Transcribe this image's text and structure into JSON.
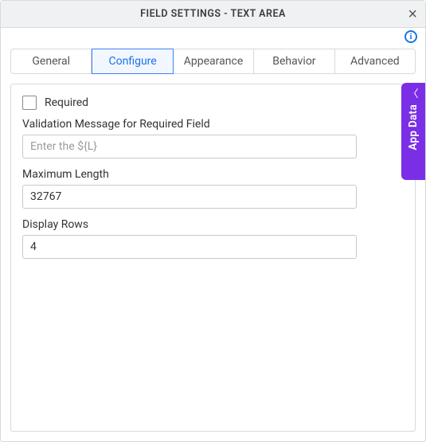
{
  "header": {
    "title": "FIELD SETTINGS - TEXT AREA"
  },
  "tabs": [
    {
      "label": "General",
      "active": false
    },
    {
      "label": "Configure",
      "active": true
    },
    {
      "label": "Appearance",
      "active": false
    },
    {
      "label": "Behavior",
      "active": false
    },
    {
      "label": "Advanced",
      "active": false
    }
  ],
  "form": {
    "required_label": "Required",
    "required_checked": false,
    "validation_label": "Validation Message for Required Field",
    "validation_placeholder": "Enter the ${L}",
    "validation_value": "",
    "maxlen_label": "Maximum Length",
    "maxlen_value": "32767",
    "rows_label": "Display Rows",
    "rows_value": "4"
  },
  "side_panel": {
    "label": "App Data"
  }
}
